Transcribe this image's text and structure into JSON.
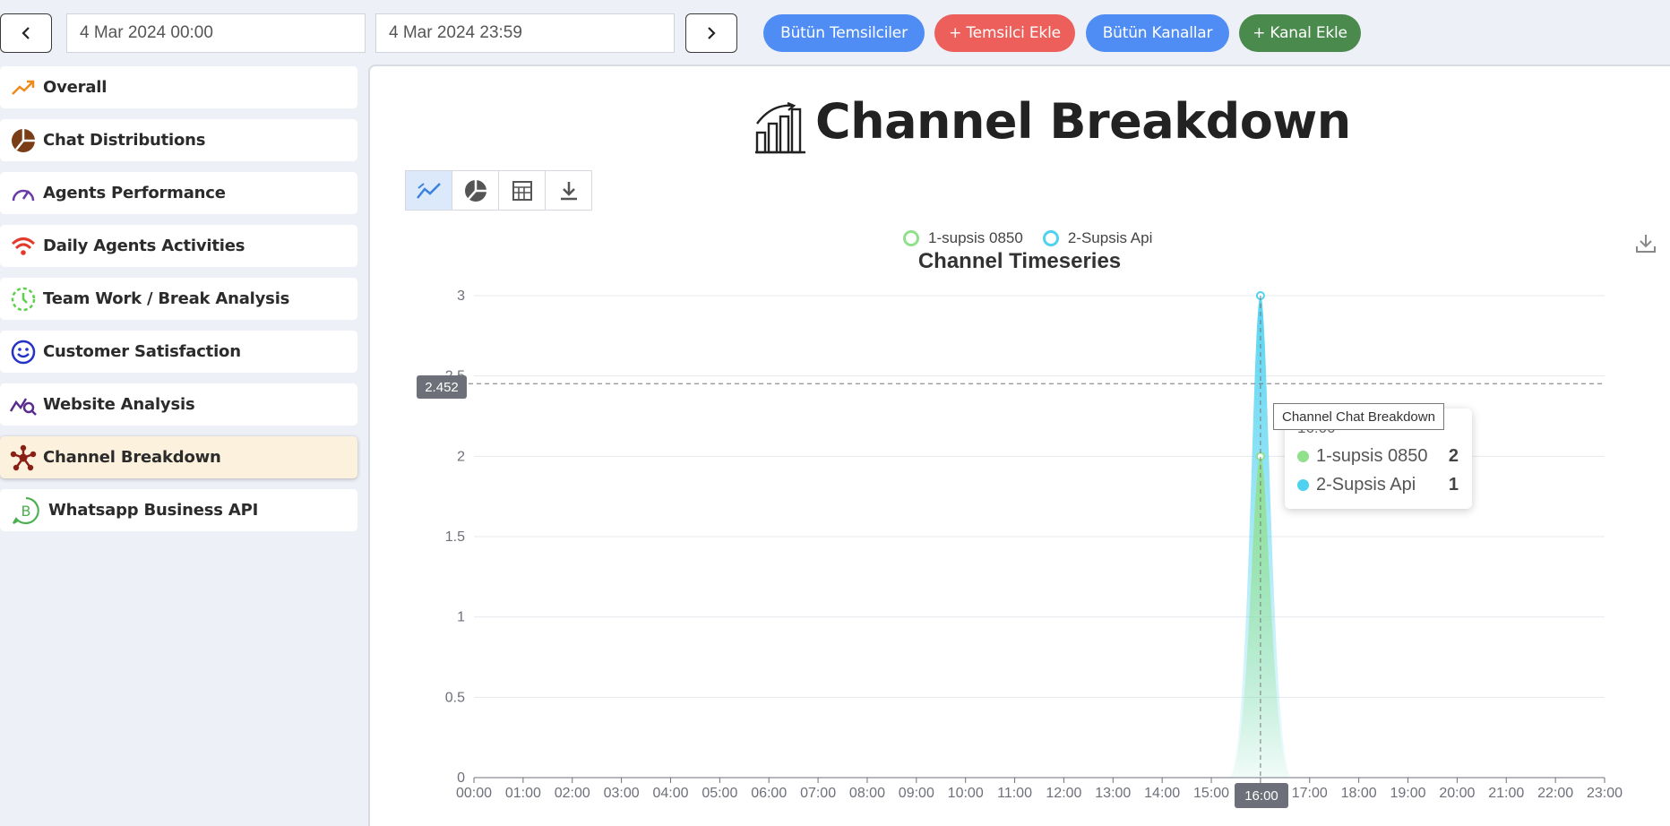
{
  "header": {
    "prev_icon": "chevron-left-icon",
    "next_icon": "chevron-right-icon",
    "start_date": "4 Mar 2024 00:00",
    "end_date": "4 Mar 2024 23:59",
    "buttons": [
      {
        "label": "Bütün Temsilciler",
        "color": "#4f8df5"
      },
      {
        "label": "+ Temsilci Ekle",
        "color": "#ec5f5a"
      },
      {
        "label": "Bütün Kanallar",
        "color": "#4f8df5"
      },
      {
        "label": "+ Kanal Ekle",
        "color": "#4a8a4c"
      }
    ]
  },
  "sidebar": {
    "items": [
      {
        "label": "Overall",
        "icon": "trend-up-icon",
        "active": false
      },
      {
        "label": "Chat Distributions",
        "icon": "pie-chart-icon",
        "active": false
      },
      {
        "label": "Agents Performance",
        "icon": "gauge-icon",
        "active": false
      },
      {
        "label": "Daily Agents Activities",
        "icon": "wifi-icon",
        "active": false
      },
      {
        "label": "Team Work / Break Analysis",
        "icon": "clock-icon",
        "active": false
      },
      {
        "label": "Customer Satisfaction",
        "icon": "smiley-icon",
        "active": false
      },
      {
        "label": "Website Analysis",
        "icon": "chart-search-icon",
        "active": false
      },
      {
        "label": "Channel Breakdown",
        "icon": "network-icon",
        "active": true
      },
      {
        "label": "Whatsapp Business API",
        "icon": "whatsapp-business-icon",
        "active": false
      }
    ]
  },
  "main": {
    "title": "Channel Breakdown",
    "title_icon": "bar-chart-growth-icon",
    "toolbar": [
      "line-chart-icon",
      "pie-chart-icon",
      "table-icon",
      "download-icon"
    ],
    "chart_download_icon": "download-icon",
    "tooltip": {
      "label": "Channel Chat Breakdown",
      "time": "16:00",
      "rows": [
        {
          "name": "1-supsis 0850",
          "value": "2",
          "color": "#91e08c"
        },
        {
          "name": "2-Supsis Api",
          "value": "1",
          "color": "#4fd2f0"
        }
      ]
    },
    "crosshair": {
      "y_value": "2.452",
      "x_value": "16:00"
    }
  },
  "chart_data": {
    "type": "area",
    "title": "Channel Timeseries",
    "x": [
      "00:00",
      "01:00",
      "02:00",
      "03:00",
      "04:00",
      "05:00",
      "06:00",
      "07:00",
      "08:00",
      "09:00",
      "10:00",
      "11:00",
      "12:00",
      "13:00",
      "14:00",
      "15:00",
      "16:00",
      "17:00",
      "18:00",
      "19:00",
      "20:00",
      "21:00",
      "22:00",
      "23:00"
    ],
    "series": [
      {
        "name": "1-supsis 0850",
        "color": "#91e08c",
        "values": [
          0,
          0,
          0,
          0,
          0,
          0,
          0,
          0,
          0,
          0,
          0,
          0,
          0,
          0,
          0,
          0,
          2,
          0,
          0,
          0,
          0,
          0,
          0,
          0
        ]
      },
      {
        "name": "2-Supsis Api",
        "color": "#4fd2f0",
        "values": [
          0,
          0,
          0,
          0,
          0,
          0,
          0,
          0,
          0,
          0,
          0,
          0,
          0,
          0,
          0,
          0,
          1,
          0,
          0,
          0,
          0,
          0,
          0,
          0
        ]
      }
    ],
    "stacked": true,
    "yticks": [
      "0",
      "0.5",
      "1",
      "1.5",
      "2",
      "2.5",
      "3"
    ],
    "ylim": [
      0,
      3
    ],
    "grid": true,
    "legend": "top-center"
  }
}
